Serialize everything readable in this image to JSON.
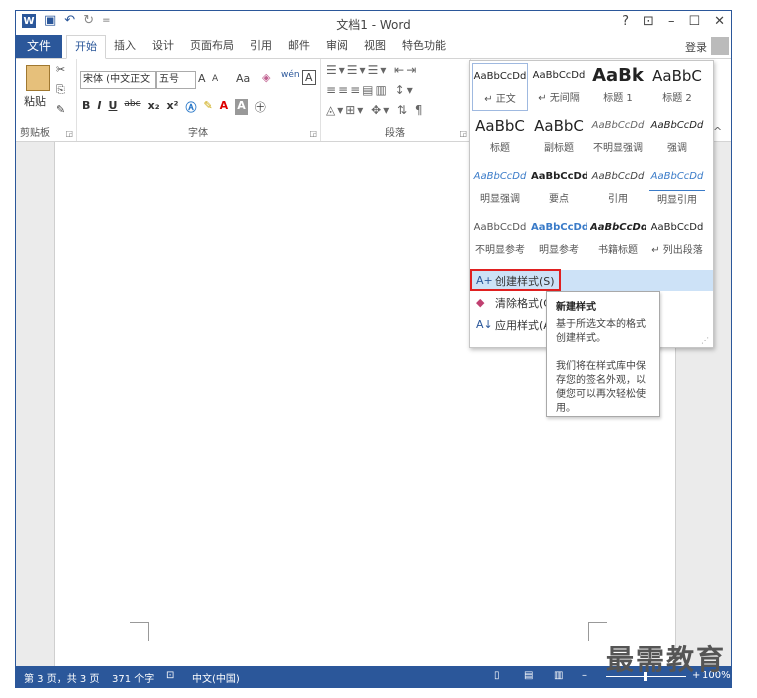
{
  "app": {
    "title": "文档1 - Word",
    "help": "?",
    "login": "登录"
  },
  "qat": {
    "undo_icon": "↶",
    "redo_icon": "↻",
    "customize": "="
  },
  "tabs": {
    "file": "文件",
    "items": [
      "开始",
      "插入",
      "设计",
      "页面布局",
      "引用",
      "邮件",
      "审阅",
      "视图",
      "特色功能"
    ]
  },
  "ribbon": {
    "clipboard": {
      "label": "剪贴板",
      "paste": "粘贴"
    },
    "font": {
      "label": "字体",
      "font_name": "宋体 (中文正文",
      "font_size": "五号",
      "grow": "A",
      "shrink": "A",
      "case": "Aa",
      "bold": "B",
      "italic": "I",
      "underline": "U",
      "strike": "abc",
      "sub": "x₂",
      "sup": "x²"
    },
    "paragraph": {
      "label": "段落"
    }
  },
  "gallery": {
    "styles": [
      {
        "sample": "AaBbCcDd",
        "name": "↵ 正文"
      },
      {
        "sample": "AaBbCcDd",
        "name": "↵ 无间隔"
      },
      {
        "sample": "AaBk",
        "name": "标题 1"
      },
      {
        "sample": "AaBbC",
        "name": "标题 2"
      },
      {
        "sample": "AaBbC",
        "name": "标题"
      },
      {
        "sample": "AaBbC",
        "name": "副标题"
      },
      {
        "sample": "AaBbCcDd",
        "name": "不明显强调"
      },
      {
        "sample": "AaBbCcDd",
        "name": "强调"
      },
      {
        "sample": "AaBbCcDd",
        "name": "明显强调"
      },
      {
        "sample": "AaBbCcDd",
        "name": "要点"
      },
      {
        "sample": "AaBbCcDd",
        "name": "引用"
      },
      {
        "sample": "AaBbCcDd",
        "name": "明显引用"
      },
      {
        "sample": "AaBbCcDd",
        "name": "不明显参考"
      },
      {
        "sample": "AaBbCcDd",
        "name": "明显参考"
      },
      {
        "sample": "AaBbCcDd",
        "name": "书籍标题"
      },
      {
        "sample": "AaBbCcDd",
        "name": "↵ 列出段落"
      }
    ],
    "menu": [
      {
        "label": "创建样式(S)"
      },
      {
        "label": "清除格式(C)"
      },
      {
        "label": "应用样式(A)..."
      }
    ]
  },
  "tooltip": {
    "title": "新建样式",
    "desc": "基于所选文本的格式创建样式。",
    "desc2": "我们将在样式库中保存您的签名外观，以便您可以再次轻松使用。"
  },
  "status": {
    "page": "第 3 页，共 3 页",
    "words": "371 个字",
    "lang": "中文(中国)",
    "zoom": "100%"
  },
  "watermark": "最需教育"
}
